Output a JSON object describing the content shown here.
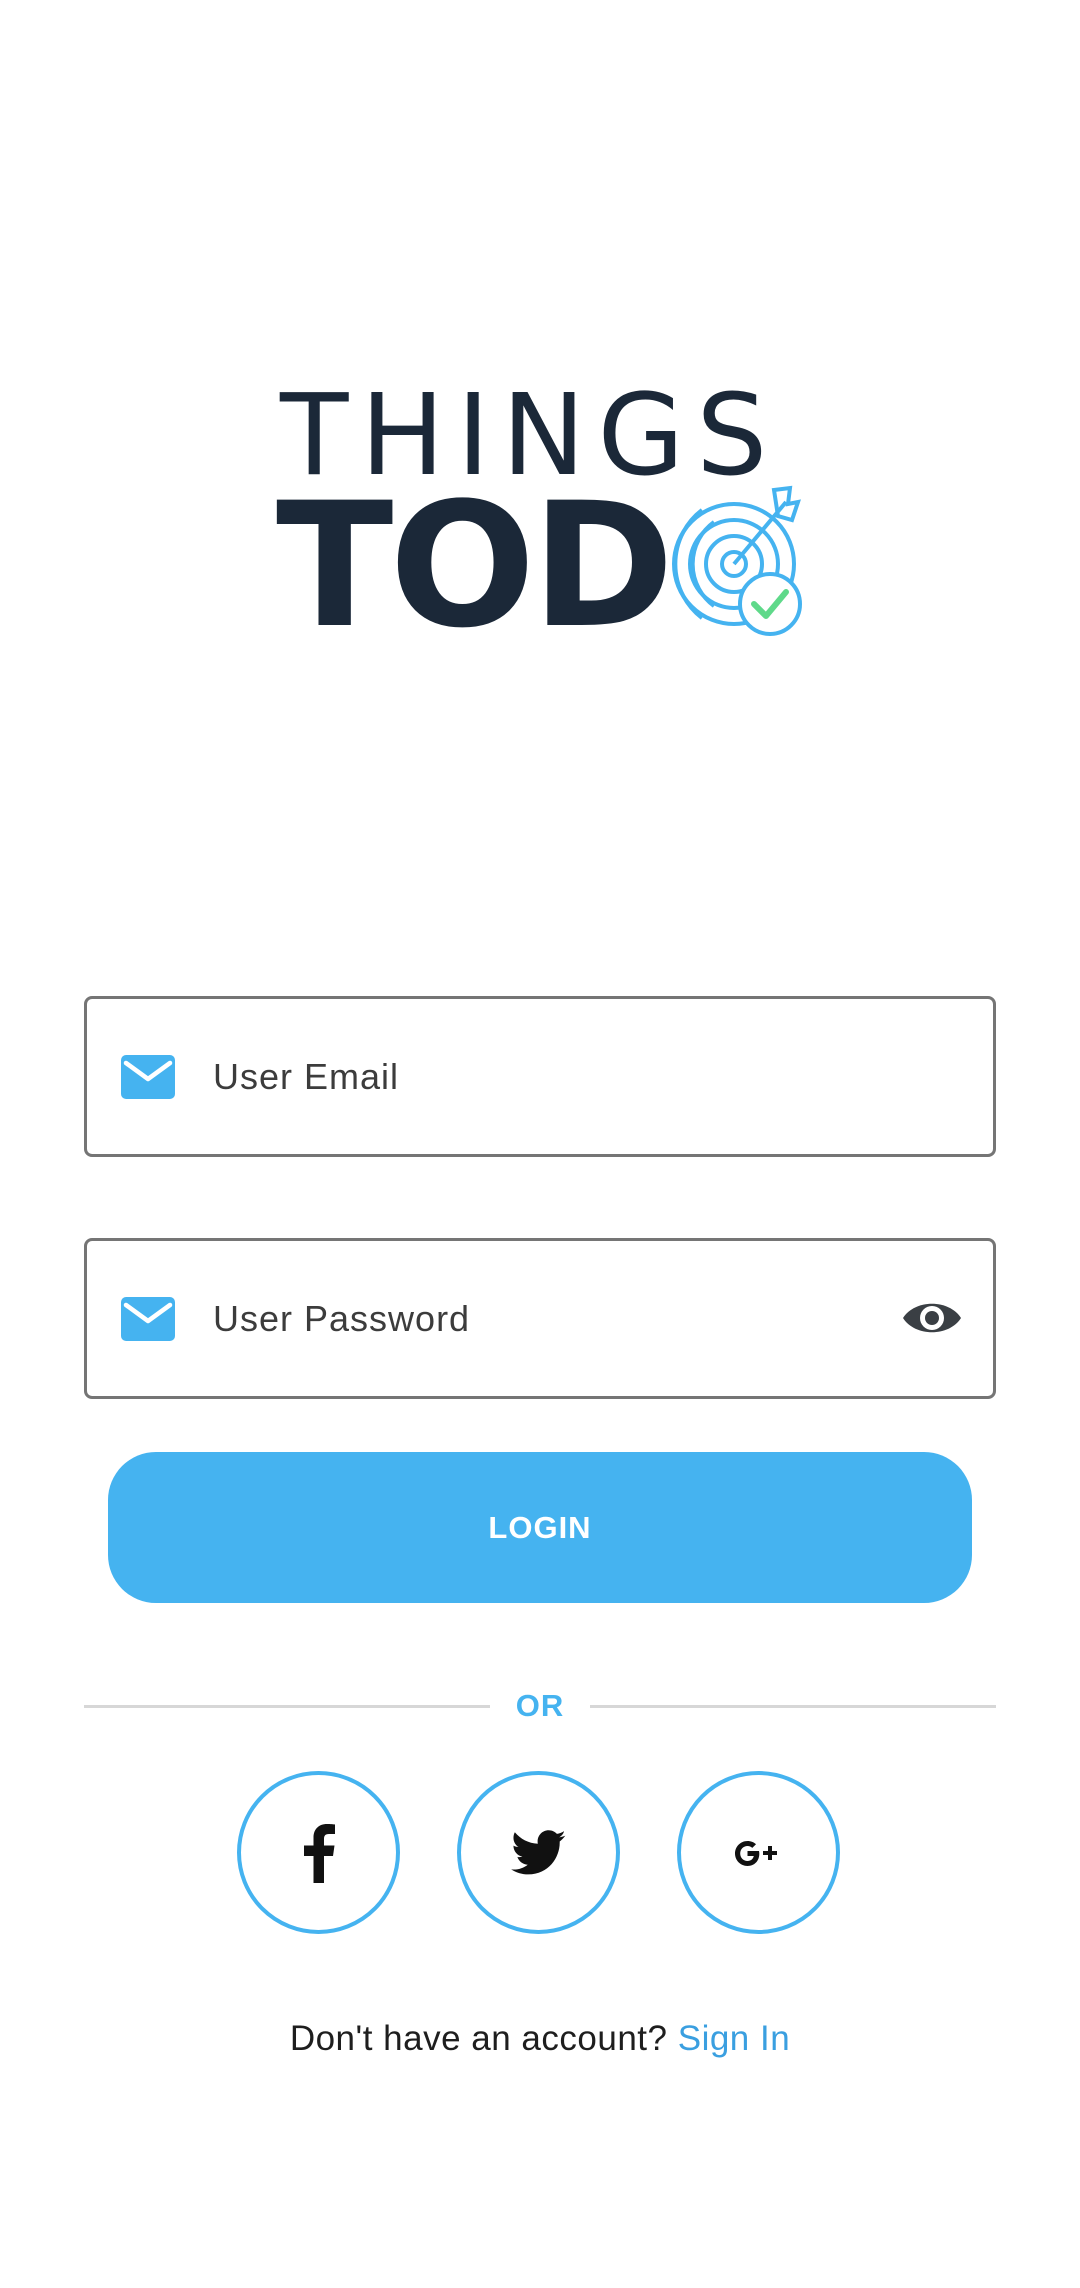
{
  "logo": {
    "line1": "THINGS",
    "line2": "TOD",
    "brand_color": "#1b2838",
    "mark_color": "#45b3f0",
    "check_color": "#5fd98a",
    "mark_icon": "target-arrow-check-icon"
  },
  "email_field": {
    "placeholder": "User Email",
    "icon": "mail-icon"
  },
  "password_field": {
    "placeholder": "User Password",
    "icon": "mail-icon",
    "toggle_icon": "eye-icon"
  },
  "login_button": {
    "label": "LOGIN",
    "color": "#45b3f0"
  },
  "divider": {
    "label": "OR"
  },
  "social": [
    {
      "icon": "facebook-icon"
    },
    {
      "icon": "twitter-icon"
    },
    {
      "icon": "google-plus-icon"
    }
  ],
  "footer": {
    "prompt": "Don't have an account?",
    "link": "Sign In"
  }
}
